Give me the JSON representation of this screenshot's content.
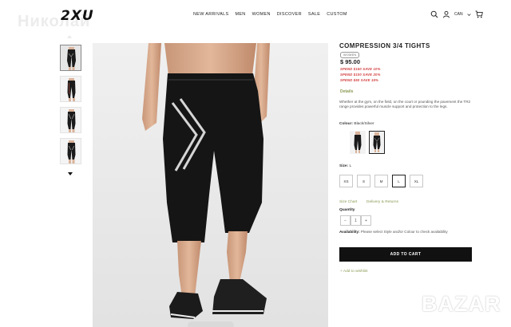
{
  "header": {
    "watermark": "Николай",
    "logo": "2XU",
    "nav": [
      "NEW ARRIVALS",
      "MEN",
      "WOMEN",
      "DISCOVER",
      "SALE",
      "CUSTOM"
    ],
    "currency": "CAN",
    "icons": [
      "search-icon",
      "user-icon",
      "chevron-down-icon",
      "cart-icon"
    ]
  },
  "gallery": {
    "thumbnail_count": 4,
    "active_index": 0
  },
  "product": {
    "title": "COMPRESSION 3/4 TIGHTS",
    "badge": "WOMEN",
    "price": "$ 95.00",
    "promos": [
      "SPEND $150 SAVE 10%",
      "SPEND $100 SAVE 20%",
      "SPEND $50 SAVE 15%"
    ],
    "details_label": "Details",
    "description": "Whether at the gym, on the field, on the court or pounding the pavement the TR2 range provides powerful muscle support and protection to the legs.",
    "color_label": "Colour:",
    "color_value": "Black/Silver",
    "size_label": "Size:",
    "size_value": "L",
    "sizes": [
      "XS",
      "S",
      "M",
      "L",
      "XL"
    ],
    "selected_size": "L",
    "size_chart": "Size Chart",
    "delivery": "Delivery & Returns",
    "quantity_label": "Quantity",
    "quantity": "1",
    "availability_label": "Availability:",
    "availability_text": "Please select Style and/or Colour to check availability",
    "add_to_cart": "ADD TO CART",
    "wishlist": "Add to wishlist"
  },
  "colors": {
    "accent": "#8a9a54",
    "promo_red": "#d23a3a",
    "button_bg": "#111111"
  },
  "watermark_bottom": "BAZAR"
}
